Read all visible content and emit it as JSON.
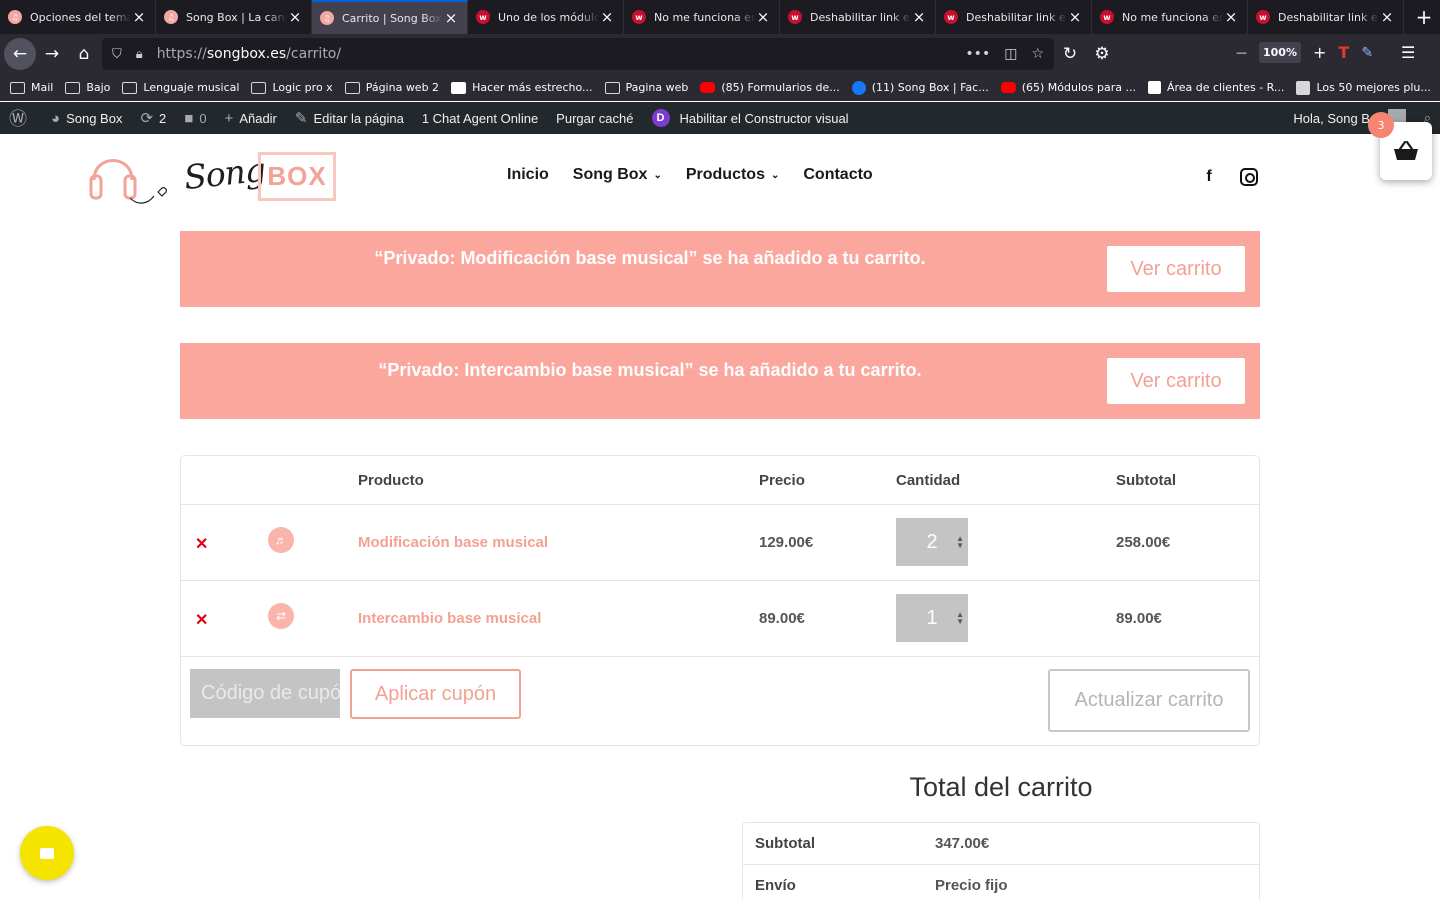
{
  "browser": {
    "tabs": [
      {
        "title": "Opciones del tema",
        "favicon": "songbox-favicon"
      },
      {
        "title": "Song Box | La canción",
        "favicon": "songbox-favicon"
      },
      {
        "title": "Carrito | Song Box",
        "favicon": "songbox-favicon",
        "active": true
      },
      {
        "title": "Uno de los módulos",
        "favicon": "w-favicon"
      },
      {
        "title": "No me funciona en",
        "favicon": "w-favicon"
      },
      {
        "title": "Deshabilitar link en",
        "favicon": "w-favicon"
      },
      {
        "title": "Deshabilitar link en",
        "favicon": "w-favicon"
      },
      {
        "title": "No me funciona en",
        "favicon": "w-favicon"
      },
      {
        "title": "Deshabilitar link en",
        "favicon": "w-favicon"
      }
    ],
    "url_prefix": "https://",
    "url_domain": "songbox.es",
    "url_path": "/carrito/",
    "zoom": "100%",
    "bookmarks": [
      {
        "label": "Mail",
        "icon": "folder"
      },
      {
        "label": "Bajo",
        "icon": "folder"
      },
      {
        "label": "Lenguaje musical",
        "icon": "folder"
      },
      {
        "label": "Logic pro x",
        "icon": "folder"
      },
      {
        "label": "Página web 2",
        "icon": "folder"
      },
      {
        "label": "Hacer más estrecho...",
        "icon": "wu"
      },
      {
        "label": "Pagina web",
        "icon": "folder"
      },
      {
        "label": "(85) Formularios de...",
        "icon": "youtube"
      },
      {
        "label": "(11) Song Box | Fac...",
        "icon": "facebook"
      },
      {
        "label": "(65) Módulos para ...",
        "icon": "youtube"
      },
      {
        "label": "Área de clientes - R...",
        "icon": "ac"
      },
      {
        "label": "Los 50 mejores plu...",
        "icon": "wp"
      }
    ]
  },
  "adminbar": {
    "site_name": "Song Box",
    "updates": "2",
    "comments": "0",
    "add_new": "Añadir",
    "edit_page": "Editar la página",
    "chat_agent": "1 Chat Agent Online",
    "purge": "Purgar caché",
    "visual_builder": "Habilitar el Constructor visual",
    "greeting": "Hola, Song Box"
  },
  "header": {
    "logo_script": "Song",
    "logo_box": "BOX",
    "nav": [
      "Inicio",
      "Song Box",
      "Productos",
      "Contacto"
    ],
    "cart_count": "3"
  },
  "notices": [
    {
      "message": "“Privado: Modificación base musical” se ha añadido a tu carrito.",
      "button": "Ver carrito"
    },
    {
      "message": "“Privado: Intercambio base musical” se ha añadido a tu carrito.",
      "button": "Ver carrito"
    }
  ],
  "cart": {
    "headers": {
      "product": "Producto",
      "price": "Precio",
      "quantity": "Cantidad",
      "subtotal": "Subtotal"
    },
    "items": [
      {
        "name": "Modificación base musical",
        "price": "129.00€",
        "quantity": "2",
        "subtotal": "258.00€"
      },
      {
        "name": "Intercambio base musical",
        "price": "89.00€",
        "quantity": "1",
        "subtotal": "89.00€"
      }
    ],
    "coupon_placeholder": "Código de cupón",
    "apply_coupon": "Aplicar cupón",
    "update_cart": "Actualizar carrito"
  },
  "totals": {
    "title": "Total del carrito",
    "rows": [
      {
        "label": "Subtotal",
        "value": "347.00€"
      },
      {
        "label": "Envío",
        "value": "Precio fijo"
      }
    ]
  },
  "colors": {
    "accent": "#f3a193",
    "notice_bg": "#fba79d",
    "admin_bar": "#23282d",
    "remove": "#e2001a",
    "chat": "#f5e300"
  }
}
